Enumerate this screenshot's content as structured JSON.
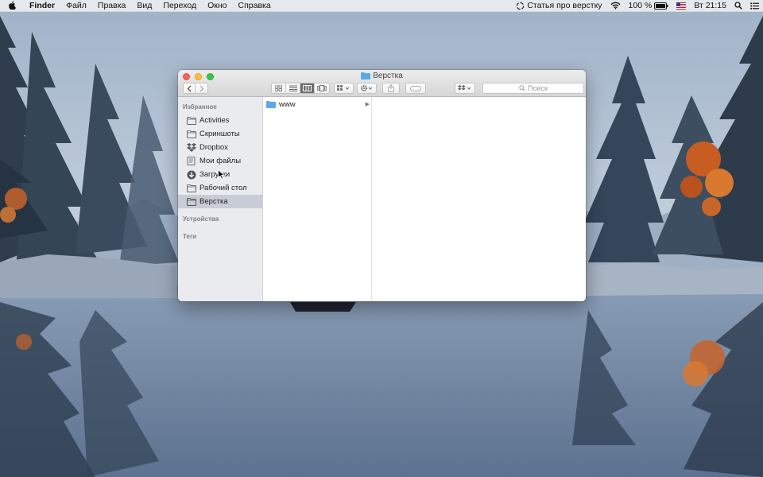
{
  "menubar": {
    "app_name": "Finder",
    "items": [
      "Файл",
      "Правка",
      "Вид",
      "Переход",
      "Окно",
      "Справка"
    ],
    "status": {
      "article_title": "Статья про верстку",
      "battery_percent": "100 %",
      "clock": "Вт 21:15"
    }
  },
  "window": {
    "title": "Верстка",
    "search_placeholder": "Поиск",
    "toolbar_icons": [
      "back-icon",
      "forward-icon",
      "icon-view-icon",
      "list-view-icon",
      "column-view-icon",
      "cover-flow-icon",
      "arrange-icon",
      "action-gear-icon",
      "share-icon",
      "tag-icon",
      "dropbox-icon",
      "search-icon"
    ],
    "active_view": "column-view"
  },
  "sidebar": {
    "favorites_header": "Избранное",
    "items": [
      {
        "label": "Activities",
        "icon": "folder-icon"
      },
      {
        "label": "Скриншоты",
        "icon": "folder-icon"
      },
      {
        "label": "Dropbox",
        "icon": "dropbox-icon"
      },
      {
        "label": "Мои файлы",
        "icon": "documents-icon"
      },
      {
        "label": "Загрузки",
        "icon": "downloads-icon"
      },
      {
        "label": "Рабочий стол",
        "icon": "folder-icon"
      },
      {
        "label": "Верстка",
        "icon": "folder-icon",
        "selected": true
      }
    ],
    "devices_header": "Устройства",
    "tags_header": "Теги"
  },
  "columns": {
    "col1": [
      {
        "name": "www",
        "icon": "folder-icon",
        "has_children": true
      }
    ]
  },
  "colors": {
    "folder_blue": "#5aa9e6",
    "selection": "#c8ccd6",
    "close": "#fc605b",
    "minimize": "#fdbc40",
    "zoom": "#34c84a"
  }
}
